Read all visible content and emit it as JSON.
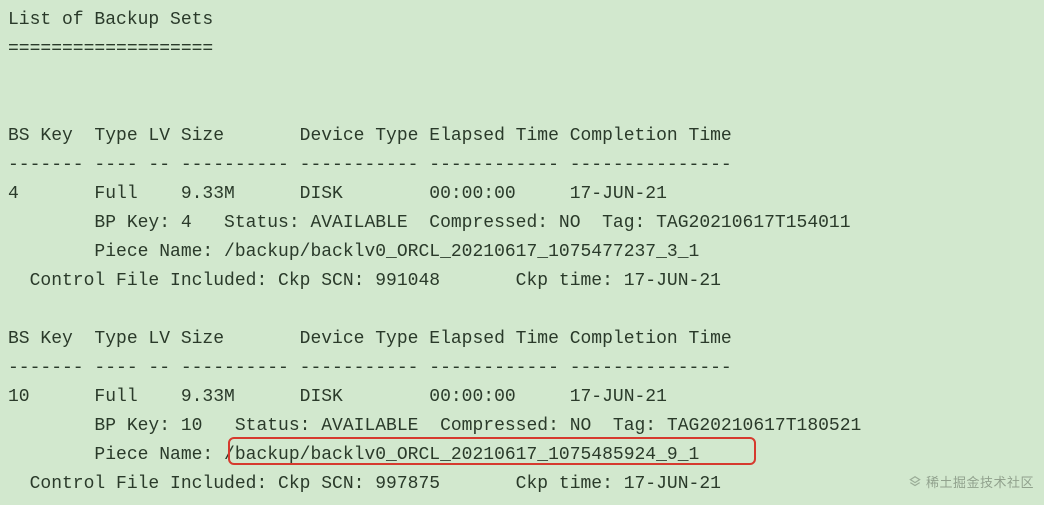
{
  "title": "List of Backup Sets",
  "title_rule": "===================",
  "columns_line": "BS Key  Type LV Size       Device Type Elapsed Time Completion Time",
  "columns_rule": "------- ---- -- ---------- ----------- ------------ ---------------",
  "backup_sets": [
    {
      "bs_key": "4",
      "type": "Full",
      "lv": "",
      "size": "9.33M",
      "device_type": "DISK",
      "elapsed_time": "00:00:00",
      "completion_time": "17-JUN-21",
      "bp_key": "4",
      "status": "AVAILABLE",
      "compressed": "NO",
      "tag": "TAG20210617T154011",
      "piece_name": "/backup/backlv0_ORCL_20210617_1075477237_3_1",
      "ctrl_ckp_scn": "991048",
      "ctrl_ckp_time": "17-JUN-21"
    },
    {
      "bs_key": "10",
      "type": "Full",
      "lv": "",
      "size": "9.33M",
      "device_type": "DISK",
      "elapsed_time": "00:00:00",
      "completion_time": "17-JUN-21",
      "bp_key": "10",
      "status": "AVAILABLE",
      "compressed": "NO",
      "tag": "TAG20210617T180521",
      "piece_name": "/backup/backlv0_ORCL_20210617_1075485924_9_1",
      "ctrl_ckp_scn": "997875",
      "ctrl_ckp_time": "17-JUN-21"
    }
  ],
  "watermark": "稀土掘金技术社区"
}
